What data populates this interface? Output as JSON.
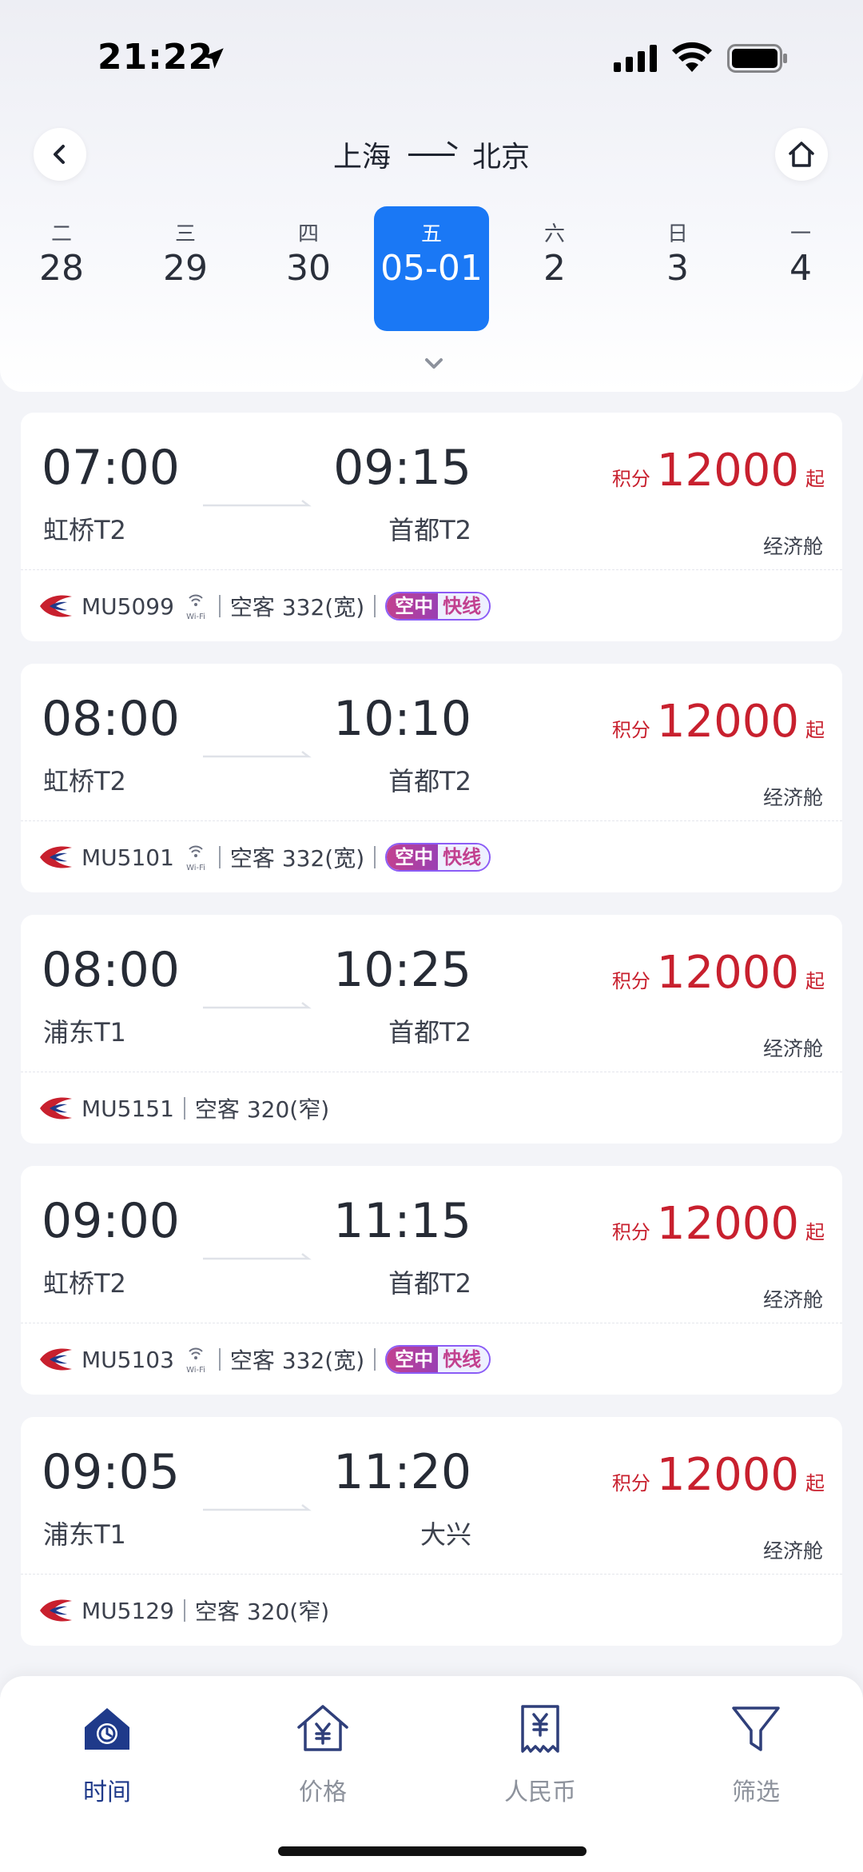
{
  "status_bar": {
    "time": "21:22"
  },
  "header": {
    "from": "上海",
    "to": "北京"
  },
  "dates": [
    {
      "weekday": "二",
      "day": "28",
      "active": false
    },
    {
      "weekday": "三",
      "day": "29",
      "active": false
    },
    {
      "weekday": "四",
      "day": "30",
      "active": false
    },
    {
      "weekday": "五",
      "day": "05-01",
      "active": true
    },
    {
      "weekday": "六",
      "day": "2",
      "active": false
    },
    {
      "weekday": "日",
      "day": "3",
      "active": false
    },
    {
      "weekday": "一",
      "day": "4",
      "active": false
    }
  ],
  "price_labels": {
    "points": "积分",
    "suffix": "起"
  },
  "flights": [
    {
      "dep_time": "07:00",
      "arr_time": "09:15",
      "dep_airport": "虹桥T2",
      "arr_airport": "首都T2",
      "price": "12000",
      "cabin": "经济舱",
      "flight_no": "MU5099",
      "wifi": true,
      "aircraft": "空客 332(宽)",
      "express": true
    },
    {
      "dep_time": "08:00",
      "arr_time": "10:10",
      "dep_airport": "虹桥T2",
      "arr_airport": "首都T2",
      "price": "12000",
      "cabin": "经济舱",
      "flight_no": "MU5101",
      "wifi": true,
      "aircraft": "空客 332(宽)",
      "express": true
    },
    {
      "dep_time": "08:00",
      "arr_time": "10:25",
      "dep_airport": "浦东T1",
      "arr_airport": "首都T2",
      "price": "12000",
      "cabin": "经济舱",
      "flight_no": "MU5151",
      "wifi": false,
      "aircraft": "空客 320(窄)",
      "express": false
    },
    {
      "dep_time": "09:00",
      "arr_time": "11:15",
      "dep_airport": "虹桥T2",
      "arr_airport": "首都T2",
      "price": "12000",
      "cabin": "经济舱",
      "flight_no": "MU5103",
      "wifi": true,
      "aircraft": "空客 332(宽)",
      "express": true
    },
    {
      "dep_time": "09:05",
      "arr_time": "11:20",
      "dep_airport": "浦东T1",
      "arr_airport": "大兴",
      "price": "12000",
      "cabin": "经济舱",
      "flight_no": "MU5129",
      "wifi": false,
      "aircraft": "空客 320(窄)",
      "express": false
    }
  ],
  "express_tag": {
    "part1": "空中",
    "part2": "快线"
  },
  "tabs": [
    {
      "label": "时间",
      "icon": "clock-house-icon",
      "active": true
    },
    {
      "label": "价格",
      "icon": "yen-house-icon",
      "active": false
    },
    {
      "label": "人民币",
      "icon": "yen-receipt-icon",
      "active": false
    },
    {
      "label": "筛选",
      "icon": "filter-funnel-icon",
      "active": false
    }
  ],
  "colors": {
    "accent": "#1a78f5",
    "price": "#c8202e",
    "tab_active": "#1f3a8a"
  }
}
